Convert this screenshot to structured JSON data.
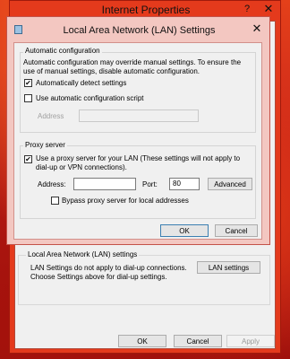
{
  "outer_window": {
    "title": "Internet Properties",
    "help_glyph": "?",
    "close_glyph": "✕",
    "lan_group_title": "Local Area Network (LAN) settings",
    "lan_text": "LAN Settings do not apply to dial-up connections. Choose Settings above for dial-up settings.",
    "lan_button": "LAN settings",
    "buttons": {
      "ok": "OK",
      "cancel": "Cancel",
      "apply": "Apply"
    }
  },
  "dialog": {
    "title": "Local Area Network (LAN) Settings",
    "close_glyph": "✕",
    "auto_config": {
      "group_title": "Automatic configuration",
      "description": "Automatic configuration may override manual settings.  To ensure the use of manual settings, disable automatic configuration.",
      "auto_detect_label": "Automatically detect settings",
      "auto_detect_checked": "✔",
      "use_script_label": "Use automatic configuration script",
      "use_script_checked": "",
      "address_label": "Address",
      "address_value": ""
    },
    "proxy": {
      "group_title": "Proxy server",
      "use_proxy_label": "Use a proxy server for your LAN (These settings will not apply to dial-up or VPN connections).",
      "use_proxy_checked": "✔",
      "address_label": "Address:",
      "address_value": "",
      "port_label": "Port:",
      "port_value": "80",
      "advanced_button": "Advanced",
      "bypass_label": "Bypass proxy server for local addresses",
      "bypass_checked": ""
    },
    "buttons": {
      "ok": "OK",
      "cancel": "Cancel"
    }
  }
}
